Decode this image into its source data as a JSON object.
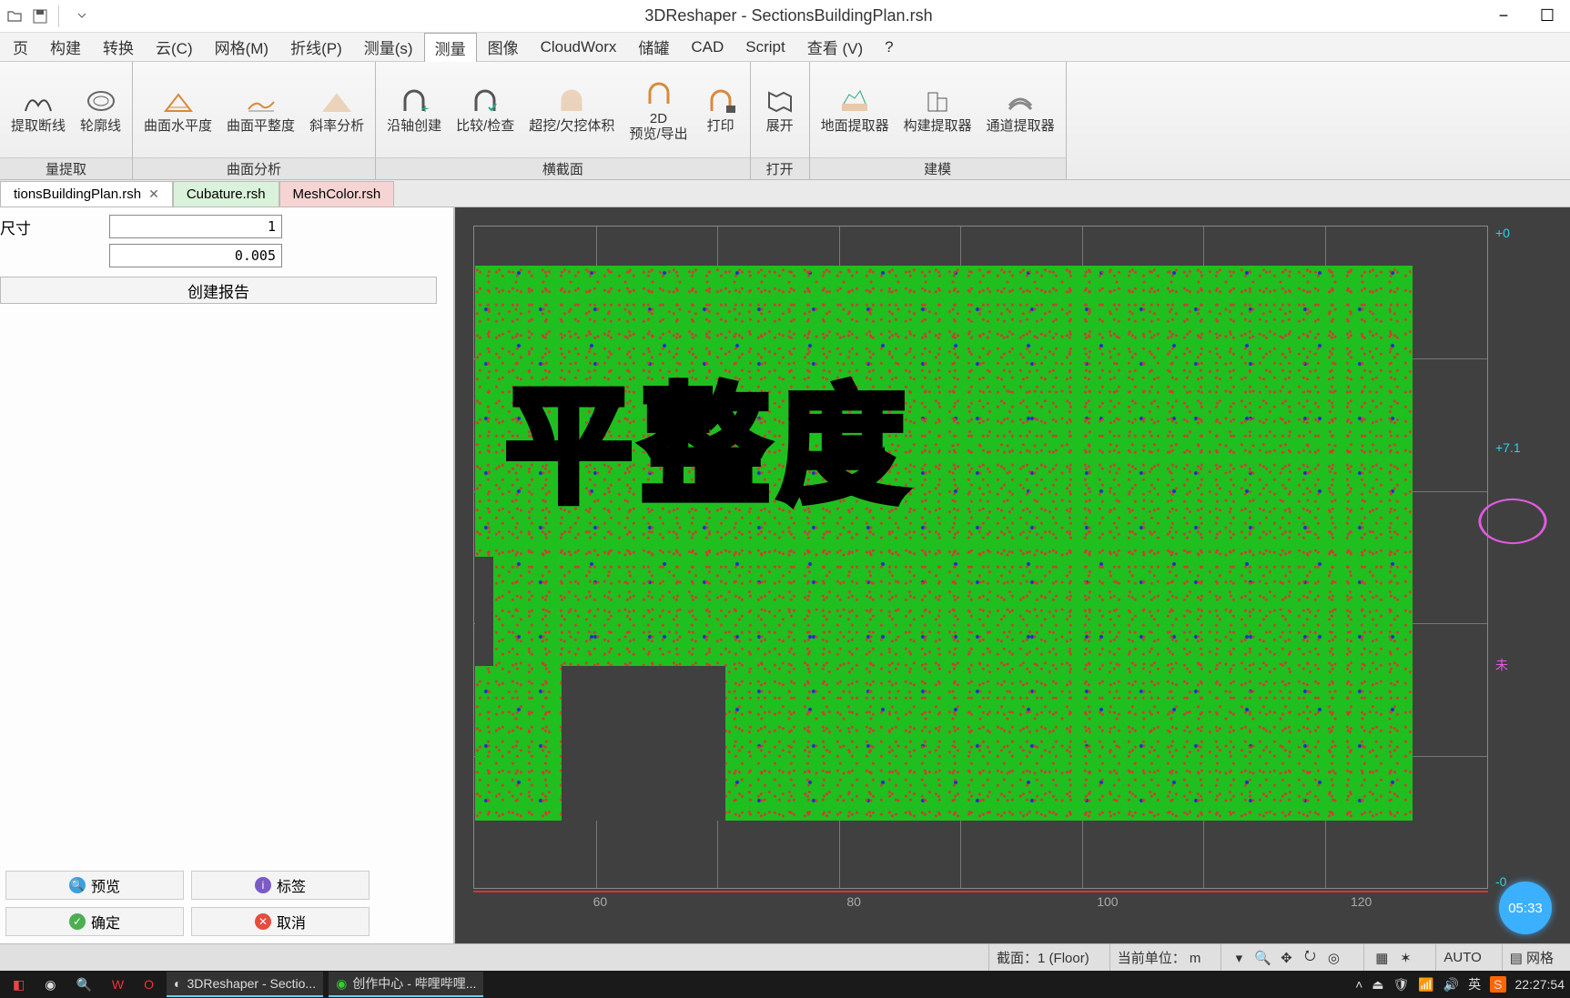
{
  "app": {
    "title": "3DReshaper - SectionsBuildingPlan.rsh"
  },
  "qat": {
    "open": "open-icon",
    "save": "save-icon"
  },
  "window_controls": {
    "minimize": "−",
    "maximize": "☐"
  },
  "menu": {
    "items": [
      "页",
      "构建",
      "转换",
      "云(C)",
      "网格(M)",
      "折线(P)",
      "测量(s)",
      "测量",
      "图像",
      "CloudWorx",
      "储罐",
      "CAD",
      "Script",
      "查看 (V)",
      "?"
    ],
    "active_index": 7
  },
  "ribbon": {
    "groups": [
      {
        "label": "量提取",
        "buttons": [
          {
            "name": "extract-section",
            "label": "提取断线"
          },
          {
            "name": "extract-contour",
            "label": "轮廓线"
          }
        ]
      },
      {
        "label": "曲面分析",
        "buttons": [
          {
            "name": "surface-levelness",
            "label": "曲面水平度"
          },
          {
            "name": "surface-flatness",
            "label": "曲面平整度"
          },
          {
            "name": "slope-analysis",
            "label": "斜率分析"
          }
        ]
      },
      {
        "label": "横截面",
        "buttons": [
          {
            "name": "alongaxis-create",
            "label": "沿轴创建"
          },
          {
            "name": "compare-check",
            "label": "比较/检查"
          },
          {
            "name": "overcut-undercut",
            "label": "超挖/欠挖体积"
          },
          {
            "name": "preview-export-2d",
            "label": "2D\n预览/导出"
          },
          {
            "name": "print",
            "label": "打印"
          }
        ]
      },
      {
        "label": "打开",
        "buttons": [
          {
            "name": "expand",
            "label": "展开"
          }
        ]
      },
      {
        "label": "建模",
        "buttons": [
          {
            "name": "floor-extractor",
            "label": "地面提取器"
          },
          {
            "name": "build-extractor",
            "label": "构建提取器"
          },
          {
            "name": "channel-extractor",
            "label": "通道提取器"
          }
        ]
      }
    ]
  },
  "doc_tabs": [
    {
      "name": "tab-sections",
      "label": "tionsBuildingPlan.rsh",
      "active": true
    },
    {
      "name": "tab-cubature",
      "label": "Cubature.rsh"
    },
    {
      "name": "tab-meshcolor",
      "label": "MeshColor.rsh"
    }
  ],
  "side_panel": {
    "dimension_label": "尺寸",
    "input1": "1",
    "input2": "0.005",
    "create_report": "创建报告",
    "preview": "预览",
    "tags": "标签",
    "ok": "确定",
    "cancel": "取消"
  },
  "viewport": {
    "overlay_text": "平整度",
    "ruler_bottom": [
      "60",
      "80",
      "100",
      "120"
    ],
    "scale_right": [
      "+0",
      "+7.1",
      "未",
      "-0"
    ],
    "timer": "05:33"
  },
  "statusbar": {
    "section": "截面：1 (Floor)",
    "unit": "当前单位： m",
    "auto": "AUTO",
    "grid": "网格"
  },
  "taskbar": {
    "app1": "3DReshaper - Sectio...",
    "app2": "创作中心 - 哔哩哔哩...",
    "ime": "英",
    "clock": "22:27:54"
  }
}
